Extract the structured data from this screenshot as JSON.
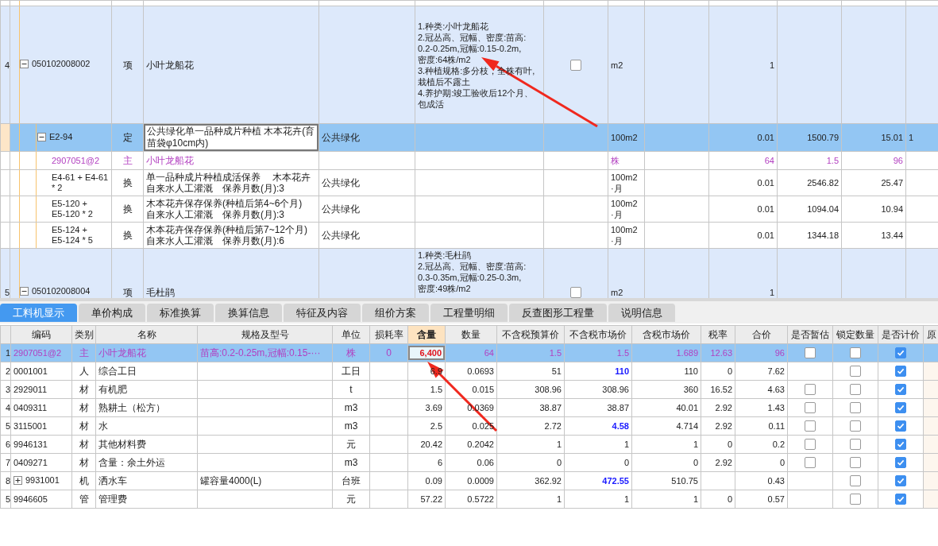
{
  "quantity_grid": {
    "rows": [
      {
        "kind": "partial",
        "selected": false
      },
      {
        "kind": "item",
        "row_number": "4",
        "selected": false,
        "expanded": true,
        "checked": false,
        "column_1": "050102008002",
        "column_2": "项",
        "column_3": "小叶龙船花",
        "column_5": "1.种类:小叶龙船花\n2.冠丛高、冠幅、密度:苗高:\n0.2-0.25m,冠幅:0.15-0.2m,\n密度:64株/m2\n3.种植规格:多分枝，全株有叶,栽植后不露土\n4.养护期:竣工验收后12个月、包成活",
        "column_7": "m2",
        "column_9": "1"
      },
      {
        "kind": "quota",
        "selected": true,
        "expanded": true,
        "editing": true,
        "column_1": "E2-94",
        "column_2": "定",
        "column_3": "公共绿化单一品种成片种植 木本花卉(育苗袋φ10cm内)",
        "column_4": "公共绿化",
        "column_7": "100m2",
        "column_9": "0.01",
        "column_10": "1500.79",
        "column_11": "15.01",
        "column_12": "1"
      },
      {
        "kind": "material",
        "selected": false,
        "column_1": "2907051@2",
        "column_2": "主",
        "column_3": "小叶龙船花",
        "column_7": "株",
        "column_9": "64",
        "column_10": "1.5",
        "column_11": "96"
      },
      {
        "kind": "conversion",
        "selected": false,
        "column_1": "E4-61 + E4-61\n* 2",
        "column_2": "换",
        "column_3": "单一品种成片种植成活保养　 木本花卉自来水人工灌溉　保养月数(月):3",
        "column_4": "公共绿化",
        "column_7": "100m2\n·月",
        "column_9": "0.01",
        "column_10": "2546.82",
        "column_11": "25.47"
      },
      {
        "kind": "conversion",
        "selected": false,
        "column_1": "E5-120 +\nE5-120 * 2",
        "column_2": "换",
        "column_3": "木本花卉保存保养(种植后第4~6个月)\n自来水人工灌溉　保养月数(月):3",
        "column_4": "公共绿化",
        "column_7": "100m2\n·月",
        "column_9": "0.01",
        "column_10": "1094.04",
        "column_11": "10.94"
      },
      {
        "kind": "conversion",
        "selected": false,
        "column_1": "E5-124 +\nE5-124 * 5",
        "column_2": "换",
        "column_3": "木本花卉保存保养(种植后第7~12个月)\n自来水人工灌溉　保养月数(月):6",
        "column_4": "公共绿化",
        "column_7": "100m2\n·月",
        "column_9": "0.01",
        "column_10": "1344.18",
        "column_11": "13.44"
      },
      {
        "kind": "item",
        "row_number": "5",
        "selected": false,
        "expanded": true,
        "checked": false,
        "column_1": "050102008004",
        "column_2": "项",
        "column_3": "毛杜鹃",
        "column_5": "1.种类:毛杜鹃\n2.冠丛高、冠幅、密度:苗高:\n0.3-0.35m,冠幅:0.25-0.3m,\n密度:49株/m2",
        "column_7": "m2",
        "column_9": "1"
      }
    ]
  },
  "tabs": [
    {
      "label": "工料机显示",
      "selected": true
    },
    {
      "label": "单价构成",
      "selected": false
    },
    {
      "label": "标准换算",
      "selected": false
    },
    {
      "label": "换算信息",
      "selected": false
    },
    {
      "label": "特征及内容",
      "selected": false
    },
    {
      "label": "组价方案",
      "selected": false
    },
    {
      "label": "工程量明细",
      "selected": false
    },
    {
      "label": "反查图形工程量",
      "selected": false
    },
    {
      "label": "说明信息",
      "selected": false
    }
  ],
  "resource_table": {
    "columns": [
      {
        "label": "编码",
        "selected": false
      },
      {
        "label": "类别",
        "selected": false
      },
      {
        "label": "名称",
        "selected": false
      },
      {
        "label": "规格及型号",
        "selected": false
      },
      {
        "label": "单位",
        "selected": false
      },
      {
        "label": "损耗率",
        "selected": false
      },
      {
        "label": "含量",
        "selected": true
      },
      {
        "label": "数量",
        "selected": false
      },
      {
        "label": "不含税预算价",
        "selected": false
      },
      {
        "label": "不含税市场价",
        "selected": false
      },
      {
        "label": "含税市场价",
        "selected": false
      },
      {
        "label": "税率",
        "selected": false
      },
      {
        "label": "合价",
        "selected": false
      },
      {
        "label": "是否暂估",
        "selected": false
      },
      {
        "label": "锁定数量",
        "selected": false
      },
      {
        "label": "是否计价",
        "selected": false
      },
      {
        "label": "原",
        "selected": false
      }
    ],
    "rows": [
      {
        "row_number": "1",
        "kind": "main",
        "selected": true,
        "editing": true,
        "code": "2907051@2",
        "category": "主",
        "name": "小叶龙船花",
        "spec": "苗高:0.2-0.25m,冠幅:0.15-···",
        "unit": "株",
        "loss_rate": "0",
        "content": "6,400",
        "quantity": "64",
        "budget_price": "1.5",
        "market_price": "1.5",
        "market_price_changed": false,
        "market_price_incl_tax": "1.689",
        "tax_rate": "12.63",
        "total": "96",
        "provisional": false,
        "locked": false,
        "priced": true
      },
      {
        "row_number": "2",
        "kind": "normal",
        "selected": false,
        "code": "0001001",
        "category": "人",
        "name": "综合工日",
        "unit": "工日",
        "content": "6.9",
        "quantity": "0.0693",
        "budget_price": "51",
        "market_price": "110",
        "market_price_changed": true,
        "market_price_incl_tax": "110",
        "tax_rate": "0",
        "total": "7.62",
        "locked": false,
        "priced": true
      },
      {
        "row_number": "3",
        "kind": "normal",
        "selected": false,
        "code": "2929011",
        "category": "材",
        "name": "有机肥",
        "unit": "t",
        "content": "1.5",
        "quantity": "0.015",
        "budget_price": "308.96",
        "market_price": "308.96",
        "market_price_changed": false,
        "market_price_incl_tax": "360",
        "tax_rate": "16.52",
        "total": "4.63",
        "provisional": false,
        "locked": false,
        "priced": true
      },
      {
        "row_number": "4",
        "kind": "normal",
        "selected": false,
        "code": "0409311",
        "category": "材",
        "name": "熟耕土（松方）",
        "unit": "m3",
        "content": "3.69",
        "quantity": "0.0369",
        "budget_price": "38.87",
        "market_price": "38.87",
        "market_price_changed": false,
        "market_price_incl_tax": "40.01",
        "tax_rate": "2.92",
        "total": "1.43",
        "provisional": false,
        "locked": false,
        "priced": true
      },
      {
        "row_number": "5",
        "kind": "normal",
        "selected": false,
        "code": "3115001",
        "category": "材",
        "name": "水",
        "unit": "m3",
        "content": "2.5",
        "quantity": "0.025",
        "budget_price": "2.72",
        "market_price": "4.58",
        "market_price_changed": true,
        "market_price_incl_tax": "4.714",
        "tax_rate": "2.92",
        "total": "0.11",
        "provisional": false,
        "locked": false,
        "priced": true
      },
      {
        "row_number": "6",
        "kind": "normal",
        "selected": false,
        "code": "9946131",
        "category": "材",
        "name": "其他材料费",
        "unit": "元",
        "content": "20.42",
        "quantity": "0.2042",
        "budget_price": "1",
        "market_price": "1",
        "market_price_changed": false,
        "market_price_incl_tax": "1",
        "tax_rate": "0",
        "total": "0.2",
        "provisional": false,
        "locked": false,
        "priced": true
      },
      {
        "row_number": "7",
        "kind": "normal",
        "selected": false,
        "code": "0409271",
        "category": "材",
        "name": "含量：余土外运",
        "unit": "m3",
        "content": "6",
        "quantity": "0.06",
        "budget_price": "0",
        "market_price": "0",
        "market_price_changed": false,
        "market_price_incl_tax": "0",
        "tax_rate": "2.92",
        "total": "0",
        "provisional": false,
        "locked": false,
        "priced": true
      },
      {
        "row_number": "8",
        "kind": "normal",
        "selected": false,
        "expanded": false,
        "code": "9931001",
        "category": "机",
        "name": "洒水车",
        "spec": "罐容量4000(L)",
        "unit": "台班",
        "content": "0.09",
        "quantity": "0.0009",
        "budget_price": "362.92",
        "market_price": "472.55",
        "market_price_changed": true,
        "market_price_incl_tax": "510.75",
        "total": "0.43",
        "locked": false,
        "priced": true
      },
      {
        "row_number": "5",
        "kind": "normal",
        "selected": false,
        "code": "9946605",
        "category": "管",
        "name": "管理费",
        "unit": "元",
        "content": "57.22",
        "quantity": "0.5722",
        "budget_price": "1",
        "market_price": "1",
        "market_price_changed": false,
        "market_price_incl_tax": "1",
        "tax_rate": "0",
        "total": "0.57",
        "locked": false,
        "priced": true
      }
    ]
  }
}
